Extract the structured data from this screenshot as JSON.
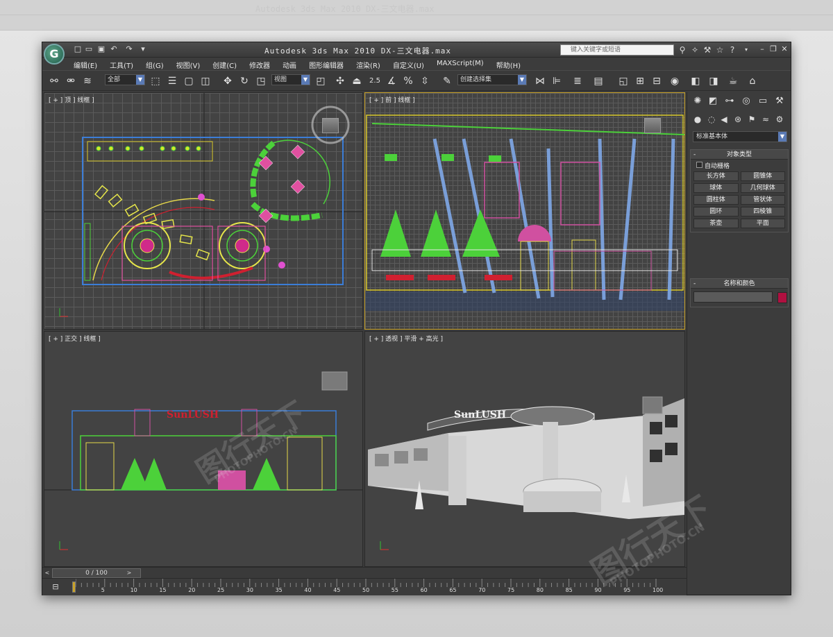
{
  "app": {
    "title": "Autodesk 3ds Max  2010    DX-三文电器.max",
    "search_placeholder": "键入关键字或短语",
    "logo_letter": "G"
  },
  "menu": [
    "编辑(E)",
    "工具(T)",
    "组(G)",
    "视图(V)",
    "创建(C)",
    "修改器",
    "动画",
    "图形编辑器",
    "渲染(R)",
    "自定义(U)",
    "MAXScript(M)",
    "帮助(H)"
  ],
  "toolbar": {
    "selection_filter": "全部",
    "reference_coord": "视图",
    "angle_snap_label": "2.5",
    "named_selection": "创建选择集"
  },
  "viewports": {
    "top": "[ + ] 顶 ] 线框 ]",
    "front_right": "[ + ] 前 ] 线框 ]",
    "left_bottom": "[ + ] 正交 ] 线框 ]",
    "perspective": "[ + ] 透视 ] 平滑 + 高光 ]",
    "sign_text": "SunLUSH"
  },
  "command_panel": {
    "category_dropdown": "标准基本体",
    "object_type_title": "对象类型",
    "autogrid_label": "自动栅格",
    "object_buttons": [
      "长方体",
      "圆锥体",
      "球体",
      "几何球体",
      "圆柱体",
      "管状体",
      "圆环",
      "四棱锥",
      "茶壶",
      "平面"
    ],
    "name_color_title": "名称和颜色",
    "color_hex": "#b01040"
  },
  "timeline": {
    "frame_display": "0 / 100",
    "ticks": [
      "5",
      "10",
      "15",
      "20",
      "25",
      "30",
      "35",
      "40",
      "45",
      "50",
      "55",
      "60",
      "65",
      "70",
      "75",
      "80",
      "85",
      "90",
      "95",
      "100"
    ]
  },
  "watermark": {
    "brand_text": "图行天下",
    "url_text": "PHOTOPHOTO.CN"
  }
}
